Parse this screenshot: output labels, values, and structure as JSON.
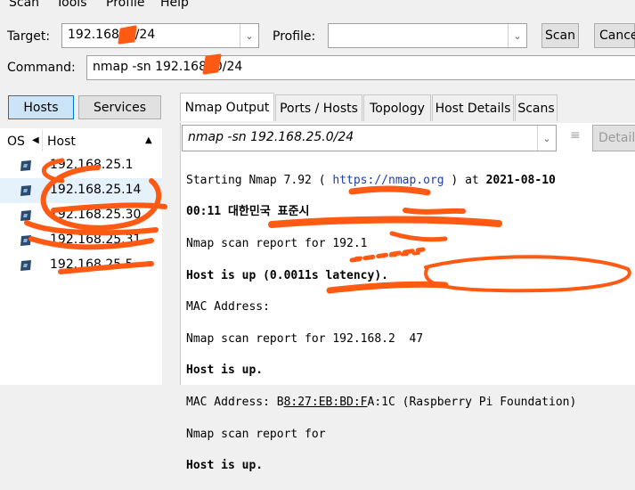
{
  "menu": [
    "Scan",
    "Tools",
    "Profile",
    "Help"
  ],
  "target": {
    "label": "Target:",
    "value": "192.168.   0/24"
  },
  "profile": {
    "label": "Profile:",
    "value": ""
  },
  "buttons": {
    "scan": "Scan",
    "cancel": "Cance"
  },
  "command": {
    "label": "Command:",
    "value": "nmap -sn 192.168.  0/24"
  },
  "left_tabs": {
    "hosts": "Hosts",
    "services": "Services"
  },
  "host_list": {
    "col_os": "OS",
    "col_host": "Host",
    "hosts": [
      "192.168.25.1",
      "192.168.25.14",
      "192.168.25.30",
      "192.168.25.31",
      "192.168.25.5"
    ]
  },
  "right_tabs": [
    "Nmap Output",
    "Ports / Hosts",
    "Topology",
    "Host Details",
    "Scans"
  ],
  "output_select": "nmap -sn 192.168.25.0/24",
  "details_button": "Details",
  "output": {
    "l1_a": "Starting Nmap 7.92 ( ",
    "l1_link": "https://nmap.org",
    "l1_b": " ) at ",
    "l1_date": "2021-08-10",
    "l2": "00:11 대한민국 표준시",
    "l3": "Nmap scan report for 192.1",
    "l4": "Host is up (0.0011s latency).",
    "l5": "MAC Address: ",
    "l6": "Nmap scan report for 192.168.2  47",
    "l7": "Host is up.",
    "l8_a": "MAC Address: B",
    "l8_b": "8:27:EB:BD:F",
    "l8_c": "A:1C (Raspberry Pi Foundation)",
    "l9": "Nmap scan report for",
    "l10": "Host is up."
  },
  "colors": {
    "scribble": "#ff5a14",
    "link": "#1d3fae",
    "selected_tab": "#cce4f7"
  }
}
